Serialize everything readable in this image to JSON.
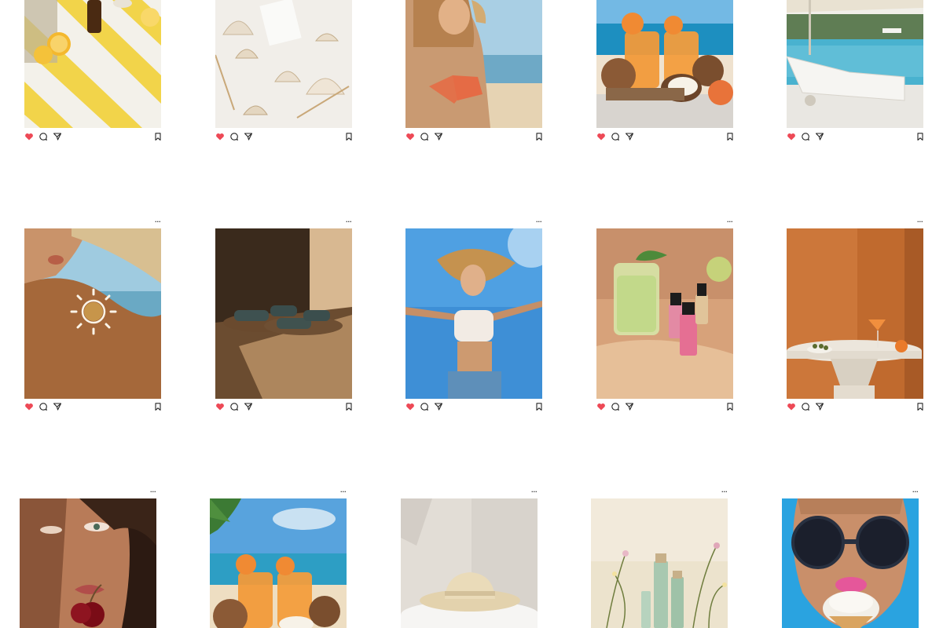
{
  "feed": {
    "posts": [
      {
        "id": "p1",
        "subject": "beach towel with lemons and oil",
        "liked": true,
        "more_label": "···"
      },
      {
        "id": "p2",
        "subject": "seashells on white sand",
        "liked": true,
        "more_label": "···"
      },
      {
        "id": "p3",
        "subject": "woman in bikini on beach",
        "liked": true,
        "more_label": "···"
      },
      {
        "id": "p4",
        "subject": "orange cocktails with coconuts",
        "liked": true,
        "more_label": "···"
      },
      {
        "id": "p5",
        "subject": "pool with lounger",
        "liked": true,
        "more_label": "···"
      },
      {
        "id": "p6",
        "subject": "sun drawn on shoulder",
        "liked": true,
        "more_label": "···"
      },
      {
        "id": "p7",
        "subject": "sandals in sunlight",
        "liked": true,
        "more_label": "···"
      },
      {
        "id": "p8",
        "subject": "jumping woman against sky",
        "liked": true,
        "more_label": "···"
      },
      {
        "id": "p9",
        "subject": "lime cocktail with nail polish",
        "liked": true,
        "more_label": "···"
      },
      {
        "id": "p10",
        "subject": "orange wall with table and cocktail",
        "liked": true,
        "more_label": "···"
      },
      {
        "id": "p11",
        "subject": "woman with cherry",
        "liked": false,
        "more_label": "···"
      },
      {
        "id": "p12",
        "subject": "cocktails on beach with palm",
        "liked": false,
        "more_label": "···"
      },
      {
        "id": "p13",
        "subject": "straw hat on pedestal",
        "liked": false,
        "more_label": "···"
      },
      {
        "id": "p14",
        "subject": "skincare bottles with flowers",
        "liked": false,
        "more_label": "···"
      },
      {
        "id": "p15",
        "subject": "woman with sunglasses and ice cream",
        "liked": false,
        "more_label": "···"
      }
    ]
  },
  "icons": {
    "like": "heart-icon",
    "comment": "comment-icon",
    "share": "send-icon",
    "save": "bookmark-icon",
    "more": "more-icon"
  },
  "colors": {
    "like_active": "#ed4956",
    "icon": "#262626",
    "background": "#ffffff"
  }
}
